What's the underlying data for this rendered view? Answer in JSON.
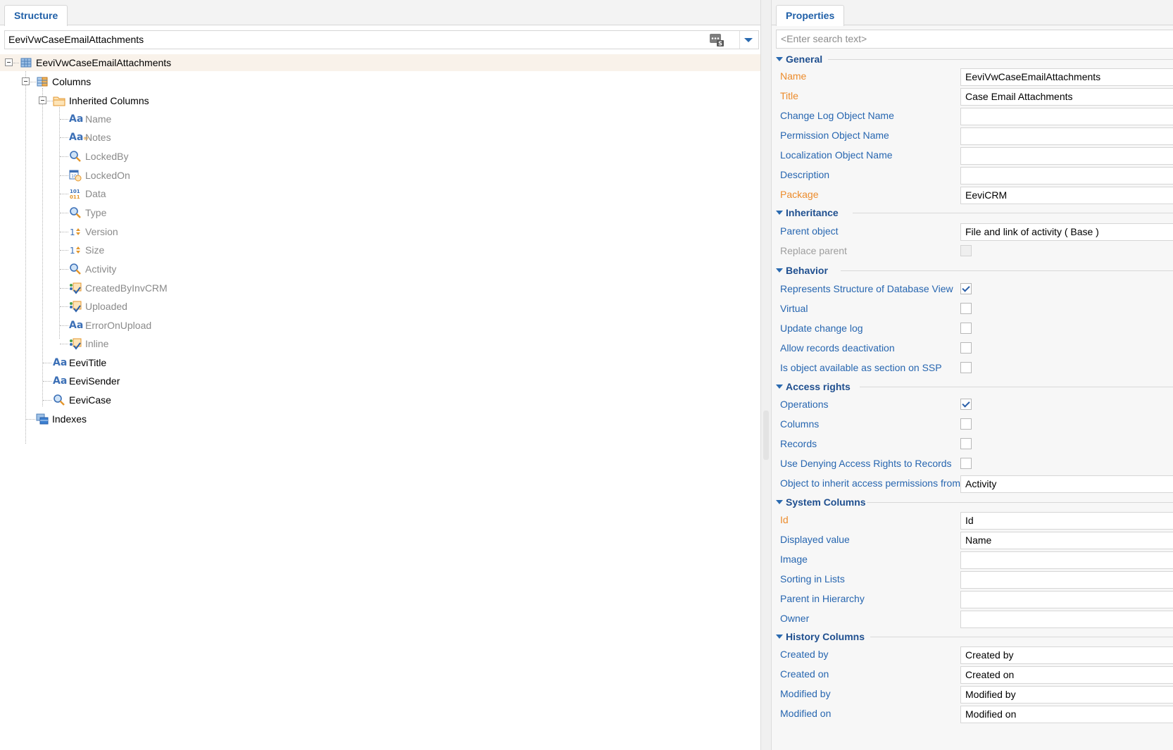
{
  "structure_panel": {
    "tab_label": "Structure",
    "schema_select": {
      "value": "EeviVwCaseEmailAttachments"
    },
    "tree": {
      "root": "EeviVwCaseEmailAttachments",
      "columns": "Columns",
      "inherited_columns": "Inherited Columns",
      "inherited": [
        {
          "label": "Name",
          "icon": "text-column-icon"
        },
        {
          "label": "Notes",
          "icon": "multiline-text-column-icon"
        },
        {
          "label": "LockedBy",
          "icon": "lookup-column-icon"
        },
        {
          "label": "LockedOn",
          "icon": "datetime-column-icon"
        },
        {
          "label": "Data",
          "icon": "binary-column-icon"
        },
        {
          "label": "Type",
          "icon": "lookup-column-icon"
        },
        {
          "label": "Version",
          "icon": "integer-column-icon"
        },
        {
          "label": "Size",
          "icon": "integer-column-icon"
        },
        {
          "label": "Activity",
          "icon": "lookup-column-icon"
        },
        {
          "label": "CreatedByInvCRM",
          "icon": "boolean-column-icon"
        },
        {
          "label": "Uploaded",
          "icon": "boolean-column-icon"
        },
        {
          "label": "ErrorOnUpload",
          "icon": "text-column-icon"
        },
        {
          "label": "Inline",
          "icon": "boolean-column-icon"
        }
      ],
      "own": [
        {
          "label": "EeviTitle",
          "icon": "text-column-icon"
        },
        {
          "label": "EeviSender",
          "icon": "text-column-icon"
        },
        {
          "label": "EeviCase",
          "icon": "lookup-column-icon"
        }
      ],
      "indexes": "Indexes"
    }
  },
  "properties_panel": {
    "tab_label": "Properties",
    "search_placeholder": "<Enter search text>",
    "groups": {
      "general": {
        "title": "General",
        "name_label": "Name",
        "name_value": "EeviVwCaseEmailAttachments",
        "title_label": "Title",
        "title_value": "Case Email Attachments",
        "change_log_label": "Change Log Object Name",
        "change_log_value": "",
        "permission_label": "Permission Object Name",
        "permission_value": "",
        "localization_label": "Localization Object Name",
        "localization_value": "",
        "description_label": "Description",
        "description_value": "",
        "package_label": "Package",
        "package_value": "EeviCRM"
      },
      "inheritance": {
        "title": "Inheritance",
        "parent_label": "Parent object",
        "parent_value": "File and link of activity ( Base )",
        "replace_label": "Replace parent",
        "replace_checked": false
      },
      "behavior": {
        "title": "Behavior",
        "represents_label": "Represents Structure of Database View",
        "represents_checked": true,
        "virtual_label": "Virtual",
        "virtual_checked": false,
        "update_log_label": "Update change log",
        "update_log_checked": false,
        "deactivation_label": "Allow records deactivation",
        "deactivation_checked": false,
        "ssp_label": "Is object available as section on SSP",
        "ssp_checked": false
      },
      "access_rights": {
        "title": "Access rights",
        "operations_label": "Operations",
        "operations_checked": true,
        "columns_label": "Columns",
        "columns_checked": false,
        "records_label": "Records",
        "records_checked": false,
        "denying_label": "Use Denying Access Rights to Records",
        "denying_checked": false,
        "inherit_label": "Object to inherit access permissions from",
        "inherit_value": "Activity"
      },
      "system_columns": {
        "title": "System Columns",
        "id_label": "Id",
        "id_value": "Id",
        "displayed_label": "Displayed value",
        "displayed_value": "Name",
        "image_label": "Image",
        "image_value": "",
        "sorting_label": "Sorting in Lists",
        "sorting_value": "",
        "parent_label": "Parent in Hierarchy",
        "parent_value": "",
        "owner_label": "Owner",
        "owner_value": ""
      },
      "history_columns": {
        "title": "History Columns",
        "created_by_label": "Created by",
        "created_by_value": "Created by",
        "created_on_label": "Created on",
        "created_on_value": "Created on",
        "modified_by_label": "Modified by",
        "modified_by_value": "Modified by",
        "modified_on_label": "Modified on",
        "modified_on_value": "Modified on"
      }
    }
  },
  "colors": {
    "tab_text": "#2060a8",
    "group_header": "#1f4f8f",
    "label": "#2766b0",
    "required_label": "#ec8b2b",
    "selected_row": "#f9f2ea",
    "inherited_text": "#8a8a8a"
  }
}
